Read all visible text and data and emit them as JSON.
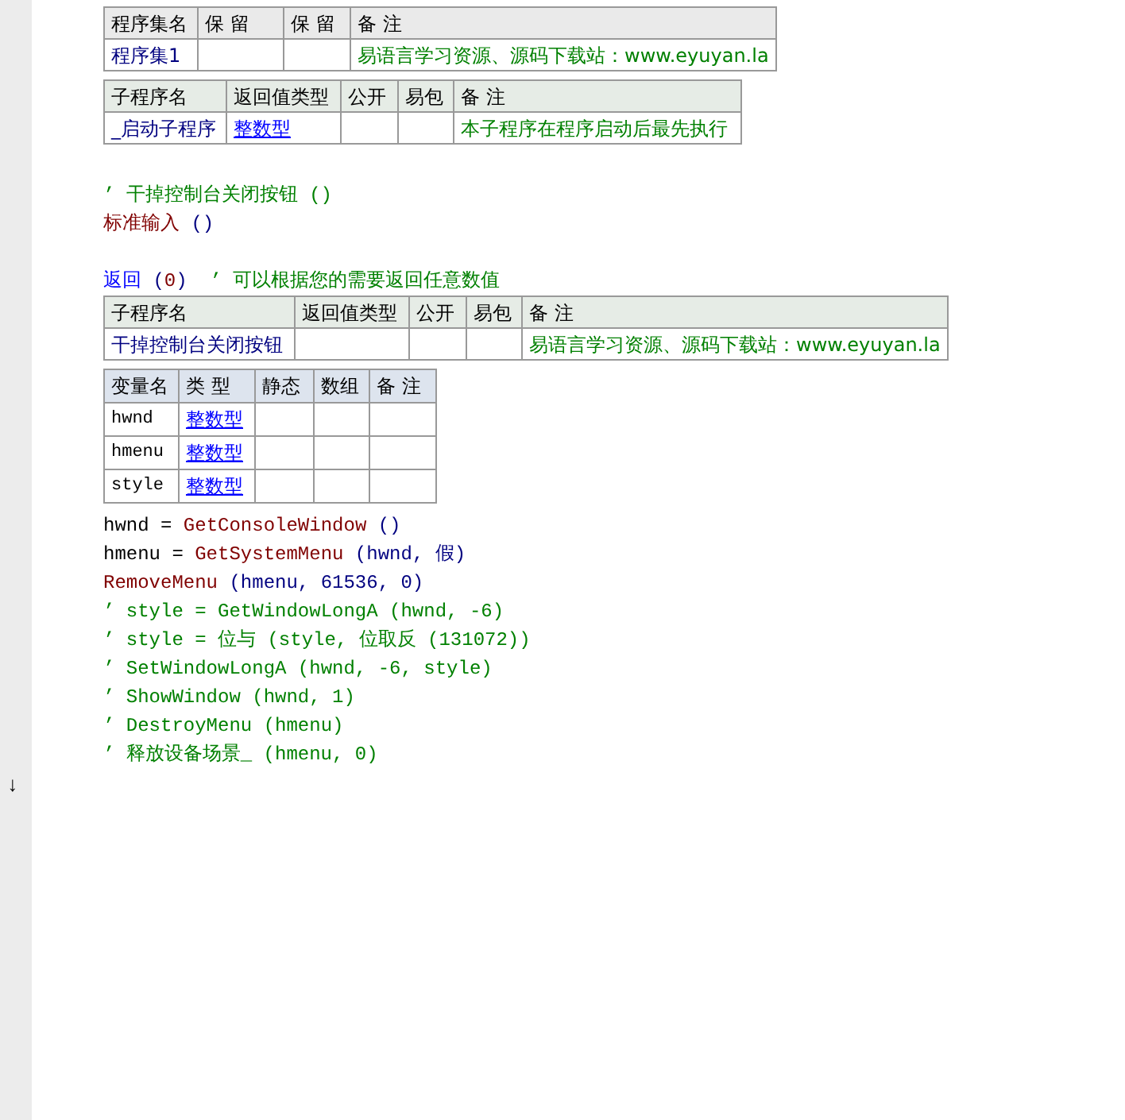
{
  "blocks": [
    {
      "kind": "assembly_table",
      "columns": [
        "程序集名",
        "保 留",
        "保 留",
        "备 注"
      ],
      "rows": [
        [
          {
            "kind": "name",
            "text": "程序集1"
          },
          {
            "kind": "empty"
          },
          {
            "kind": "empty"
          },
          {
            "kind": "remark",
            "text": "易语言学习资源、源码下载站：www.eyuyan.la"
          }
        ]
      ]
    },
    {
      "kind": "sub_table",
      "columns": [
        "子程序名",
        "返回值类型",
        "公开",
        "易包",
        "备 注"
      ],
      "rows": [
        [
          {
            "kind": "name",
            "text": "_启动子程序"
          },
          {
            "kind": "type",
            "text": "整数型"
          },
          {
            "kind": "empty"
          },
          {
            "kind": "empty"
          },
          {
            "kind": "remark",
            "text": "本子程序在程序启动后最先执行"
          }
        ]
      ]
    },
    {
      "kind": "blank"
    },
    {
      "kind": "code",
      "segments": [
        {
          "kind": "comment",
          "text": "’ 干掉控制台关闭按钮 ()"
        }
      ]
    },
    {
      "kind": "code",
      "segments": [
        {
          "kind": "func",
          "text": "标准输入"
        },
        {
          "kind": "paren",
          "text": " ()"
        }
      ]
    },
    {
      "kind": "blank"
    },
    {
      "kind": "code",
      "segments": [
        {
          "kind": "keyword",
          "text": "返回"
        },
        {
          "kind": "paren",
          "text": " ("
        },
        {
          "kind": "func",
          "text": "0"
        },
        {
          "kind": "paren",
          "text": ")"
        },
        {
          "kind": "comment",
          "text": "  ’ 可以根据您的需要返回任意数值"
        }
      ]
    },
    {
      "kind": "sub_table",
      "columns": [
        "子程序名",
        "返回值类型",
        "公开",
        "易包",
        "备 注"
      ],
      "rows": [
        [
          {
            "kind": "name",
            "text": "干掉控制台关闭按钮"
          },
          {
            "kind": "empty"
          },
          {
            "kind": "empty"
          },
          {
            "kind": "empty"
          },
          {
            "kind": "remark",
            "text": "易语言学习资源、源码下载站：www.eyuyan.la"
          }
        ]
      ]
    },
    {
      "kind": "var_table",
      "columns": [
        "变量名",
        "类 型",
        "静态",
        "数组",
        "备 注"
      ],
      "rows": [
        [
          {
            "kind": "plain",
            "text": "hwnd"
          },
          {
            "kind": "type",
            "text": "整数型"
          },
          {
            "kind": "empty"
          },
          {
            "kind": "empty"
          },
          {
            "kind": "empty"
          }
        ],
        [
          {
            "kind": "plain",
            "text": "hmenu"
          },
          {
            "kind": "type",
            "text": "整数型"
          },
          {
            "kind": "empty"
          },
          {
            "kind": "empty"
          },
          {
            "kind": "empty"
          }
        ],
        [
          {
            "kind": "plain",
            "text": "style"
          },
          {
            "kind": "type",
            "text": "整数型"
          },
          {
            "kind": "empty"
          },
          {
            "kind": "empty"
          },
          {
            "kind": "empty"
          }
        ]
      ]
    },
    {
      "kind": "code",
      "segments": [
        {
          "kind": "plain",
          "text": "hwnd = "
        },
        {
          "kind": "func",
          "text": "GetConsoleWindow"
        },
        {
          "kind": "paren",
          "text": " ()"
        }
      ]
    },
    {
      "kind": "code",
      "segments": [
        {
          "kind": "plain",
          "text": "hmenu = "
        },
        {
          "kind": "func",
          "text": "GetSystemMenu"
        },
        {
          "kind": "paren",
          "text": " (hwnd, 假)"
        }
      ]
    },
    {
      "kind": "code",
      "segments": [
        {
          "kind": "func",
          "text": "RemoveMenu"
        },
        {
          "kind": "paren",
          "text": " (hmenu, 61536, 0)"
        }
      ]
    },
    {
      "kind": "code",
      "segments": [
        {
          "kind": "comment",
          "text": "’ style = GetWindowLongA (hwnd, -6)"
        }
      ]
    },
    {
      "kind": "code",
      "segments": [
        {
          "kind": "comment",
          "text": "’ style = 位与 (style, 位取反 (131072))"
        }
      ]
    },
    {
      "kind": "code",
      "segments": [
        {
          "kind": "comment",
          "text": "’ SetWindowLongA (hwnd, -6, style)"
        }
      ]
    },
    {
      "kind": "code",
      "segments": [
        {
          "kind": "comment",
          "text": "’ ShowWindow (hwnd, 1)"
        }
      ]
    },
    {
      "kind": "code",
      "segments": [
        {
          "kind": "comment",
          "text": "’ DestroyMenu (hmenu)"
        }
      ]
    },
    {
      "kind": "code",
      "segments": [
        {
          "kind": "comment",
          "text": "’ 释放设备场景_ (hmenu, 0)"
        }
      ]
    }
  ],
  "gutter_mark": "↓"
}
